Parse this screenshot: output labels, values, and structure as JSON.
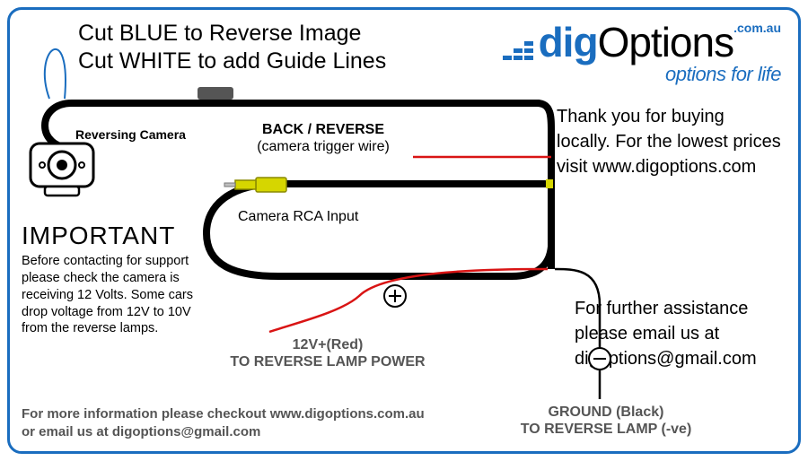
{
  "instructions": {
    "line1": "Cut BLUE to Reverse Image",
    "line2": "Cut WHITE to add Guide Lines"
  },
  "logo": {
    "dig": "dig",
    "options": "Options",
    "comau": ".com.au",
    "tagline": "options for life"
  },
  "thankyou": "Thank you for buying locally. For the lowest prices visit www.digoptions.com",
  "assist": "For further assistance please email us at digoptions@gmail.com",
  "important": {
    "heading": "IMPORTANT",
    "body": "Before contacting for support please check the camera is receiving 12 Volts. Some cars drop voltage from 12V to 10V from the reverse lamps."
  },
  "footer": {
    "line1": "For more information please checkout www.digoptions.com.au",
    "line2": "or email us at digoptions@gmail.com"
  },
  "labels": {
    "reversing_camera": "Reversing Camera",
    "back_reverse": "BACK / REVERSE",
    "trigger_wire": "(camera trigger wire)",
    "rca_input": "Camera RCA Input",
    "power_12v": "12V+(Red)",
    "power_sub": "TO REVERSE LAMP POWER",
    "ground": "GROUND (Black)",
    "ground_sub": "TO REVERSE LAMP (-ve)"
  },
  "colors": {
    "brand": "#1a6dbf",
    "wire_red": "#d91414",
    "wire_black": "#000000",
    "rca_yellow": "#d6d600"
  }
}
